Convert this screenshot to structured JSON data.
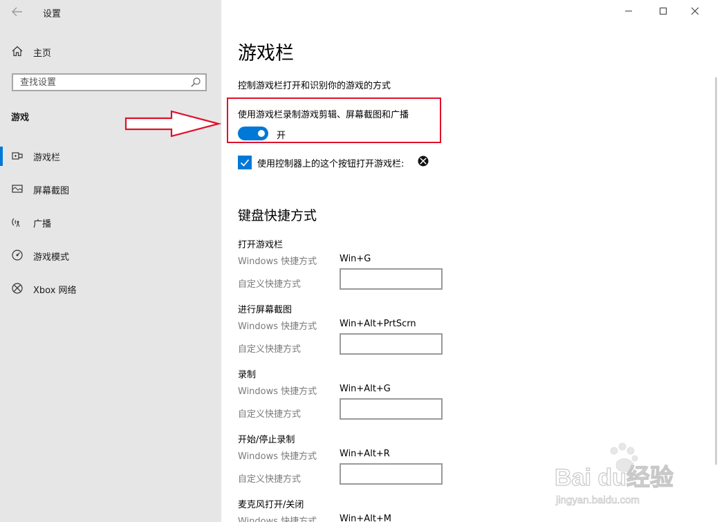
{
  "app": {
    "title": "设置"
  },
  "sidebar": {
    "home_label": "主页",
    "search_placeholder": "查找设置",
    "section_header": "游戏",
    "items": [
      {
        "label": "游戏栏",
        "icon": "game-bar-icon",
        "active": true
      },
      {
        "label": "屏幕截图",
        "icon": "captures-icon",
        "active": false
      },
      {
        "label": "广播",
        "icon": "broadcast-icon",
        "active": false
      },
      {
        "label": "游戏模式",
        "icon": "game-mode-icon",
        "active": false
      },
      {
        "label": "Xbox 网络",
        "icon": "xbox-icon",
        "active": false
      }
    ]
  },
  "main": {
    "title": "游戏栏",
    "description": "控制游戏栏打开和识别你的游戏的方式",
    "toggle": {
      "caption": "使用游戏栏录制游戏剪辑、屏幕截图和广播",
      "state_label": "开",
      "on": true
    },
    "checkbox": {
      "label": "使用控制器上的这个按钮打开游戏栏:",
      "checked": true
    },
    "keyboard_section_title": "键盘快捷方式",
    "shortcuts": [
      {
        "name": "打开游戏栏",
        "win_label": "Windows 快捷方式",
        "win_value": "Win+G",
        "custom_label": "自定义快捷方式"
      },
      {
        "name": "进行屏幕截图",
        "win_label": "Windows 快捷方式",
        "win_value": "Win+Alt+PrtScrn",
        "custom_label": "自定义快捷方式"
      },
      {
        "name": "录制",
        "win_label": "Windows 快捷方式",
        "win_value": "Win+Alt+G",
        "custom_label": "自定义快捷方式"
      },
      {
        "name": "开始/停止录制",
        "win_label": "Windows 快捷方式",
        "win_value": "Win+Alt+R",
        "custom_label": "自定义快捷方式"
      },
      {
        "name": "麦克风打开/关闭",
        "win_label": "Windows 快捷方式",
        "win_value": "Win+Alt+M",
        "custom_label": ""
      }
    ]
  },
  "watermark": {
    "brand": "Bai  du经验",
    "url": "jingyan.baidu.com"
  },
  "colors": {
    "accent": "#0078d7",
    "highlight": "#e0102a",
    "sidebar_bg": "#e6e6e6"
  }
}
